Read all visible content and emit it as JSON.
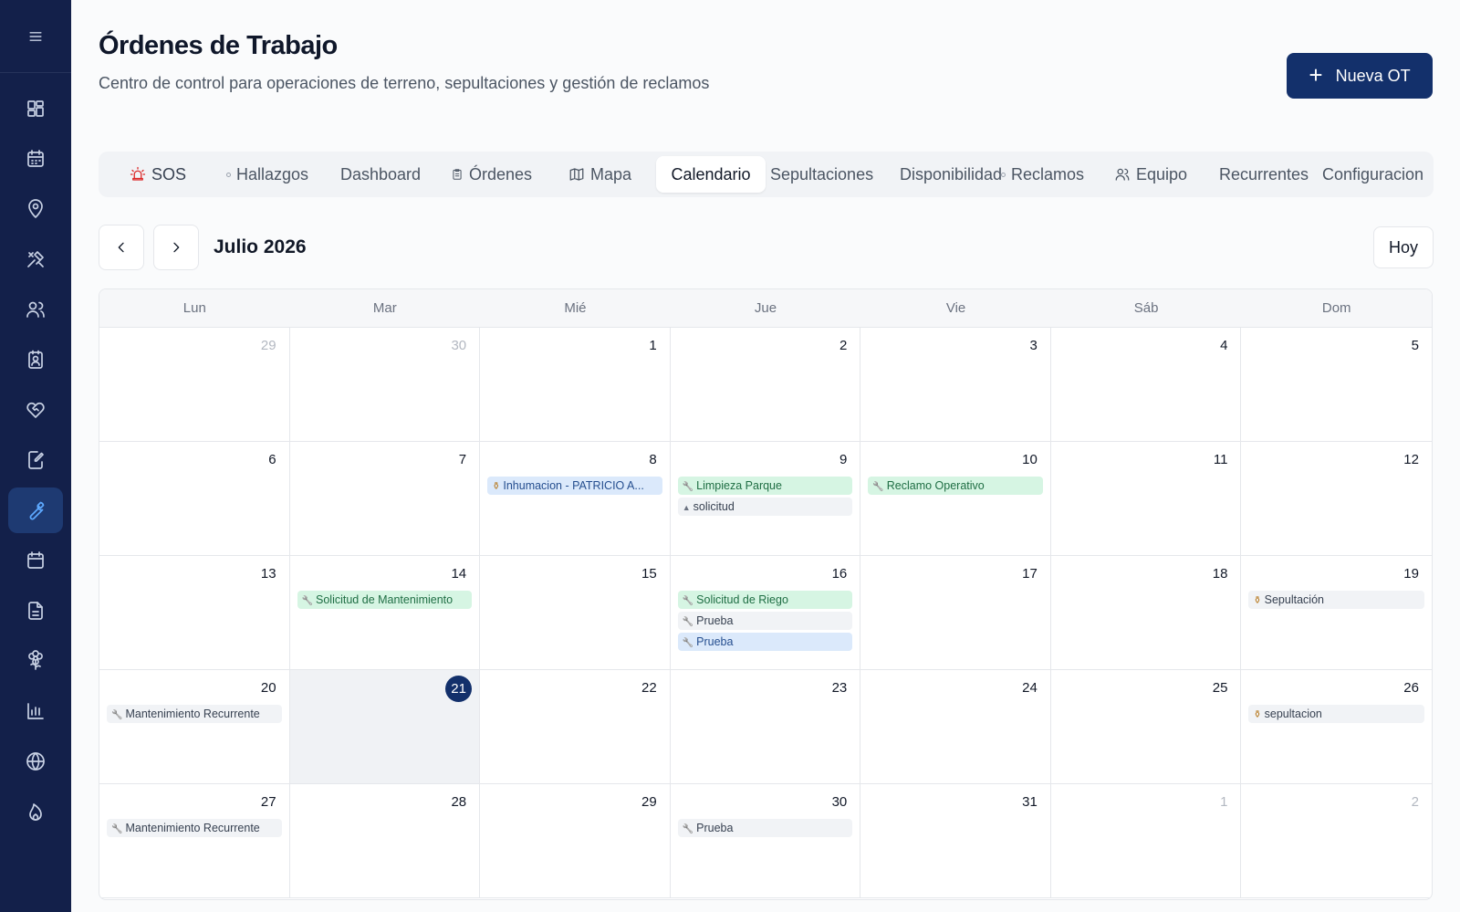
{
  "sidebar": {
    "menu_icon": "hamburger-icon",
    "items": [
      {
        "icon": "dashboard-grid-icon"
      },
      {
        "icon": "calendar-icon"
      },
      {
        "icon": "map-pin-icon"
      },
      {
        "icon": "tools-icon"
      },
      {
        "icon": "users-icon"
      },
      {
        "icon": "badge-icon"
      },
      {
        "icon": "heart-handshake-icon"
      },
      {
        "icon": "edit-document-icon"
      },
      {
        "icon": "wrench-icon",
        "active": true
      },
      {
        "icon": "calendar-outline-icon"
      },
      {
        "icon": "document-icon"
      },
      {
        "icon": "flower-icon"
      },
      {
        "icon": "bar-chart-icon"
      },
      {
        "icon": "globe-icon"
      },
      {
        "icon": "flame-icon"
      }
    ]
  },
  "header": {
    "title": "Órdenes de Trabajo",
    "subtitle": "Centro de control para operaciones de terreno, sepultaciones y gestión de reclamos",
    "new_button": "Nueva OT"
  },
  "tabs": [
    {
      "label": "SOS",
      "icon": "siren-icon"
    },
    {
      "label": "Hallazgos",
      "icon": "dot-icon"
    },
    {
      "label": "Dashboard"
    },
    {
      "label": "Órdenes",
      "icon": "clipboard-icon"
    },
    {
      "label": "Mapa",
      "icon": "map-icon"
    },
    {
      "label": "Calendario",
      "active": true
    },
    {
      "label": "Sepultaciones"
    },
    {
      "label": "Disponibilidad"
    },
    {
      "label": "Reclamos",
      "icon": "dot-icon"
    },
    {
      "label": "Equipo",
      "icon": "users-icon"
    },
    {
      "label": "Recurrentes"
    },
    {
      "label": "Configuracion"
    }
  ],
  "calendar": {
    "month_label": "Julio 2026",
    "today_button": "Hoy",
    "weekdays": [
      "Lun",
      "Mar",
      "Mié",
      "Jue",
      "Vie",
      "Sáb",
      "Dom"
    ],
    "today": 21,
    "weeks": [
      [
        {
          "day": "29",
          "muted": true,
          "events": []
        },
        {
          "day": "30",
          "muted": true,
          "events": []
        },
        {
          "day": "1",
          "events": []
        },
        {
          "day": "2",
          "events": []
        },
        {
          "day": "3",
          "events": []
        },
        {
          "day": "4",
          "events": []
        },
        {
          "day": "5",
          "events": []
        }
      ],
      [
        {
          "day": "6",
          "events": []
        },
        {
          "day": "7",
          "events": []
        },
        {
          "day": "8",
          "events": [
            {
              "label": "Inhumacion - PATRICIO A...",
              "color": "blue",
              "icon": "urn-icon"
            }
          ]
        },
        {
          "day": "9",
          "events": [
            {
              "label": "Limpieza Parque",
              "color": "green",
              "icon": "wrench-icon"
            },
            {
              "label": "solicitud",
              "color": "gray",
              "icon": "tombstone-icon"
            }
          ]
        },
        {
          "day": "10",
          "events": [
            {
              "label": "Reclamo Operativo",
              "color": "green",
              "icon": "wrench-icon"
            }
          ]
        },
        {
          "day": "11",
          "events": []
        },
        {
          "day": "12",
          "events": []
        }
      ],
      [
        {
          "day": "13",
          "events": []
        },
        {
          "day": "14",
          "events": [
            {
              "label": "Solicitud de Mantenimiento",
              "color": "green",
              "icon": "wrench-icon"
            }
          ]
        },
        {
          "day": "15",
          "events": []
        },
        {
          "day": "16",
          "events": [
            {
              "label": "Solicitud de Riego",
              "color": "green",
              "icon": "wrench-icon"
            },
            {
              "label": "Prueba",
              "color": "gray",
              "icon": "wrench-icon"
            },
            {
              "label": "Prueba",
              "color": "blue",
              "icon": "wrench-icon"
            }
          ]
        },
        {
          "day": "17",
          "events": []
        },
        {
          "day": "18",
          "events": []
        },
        {
          "day": "19",
          "events": [
            {
              "label": "Sepultación",
              "color": "gray",
              "icon": "urn-icon"
            }
          ]
        }
      ],
      [
        {
          "day": "20",
          "events": [
            {
              "label": "Mantenimiento Recurrente",
              "color": "gray",
              "icon": "wrench-icon"
            }
          ]
        },
        {
          "day": "21",
          "today": true,
          "events": []
        },
        {
          "day": "22",
          "events": []
        },
        {
          "day": "23",
          "events": []
        },
        {
          "day": "24",
          "events": []
        },
        {
          "day": "25",
          "events": []
        },
        {
          "day": "26",
          "events": [
            {
              "label": "sepultacion",
              "color": "gray",
              "icon": "urn-icon"
            }
          ]
        }
      ],
      [
        {
          "day": "27",
          "events": [
            {
              "label": "Mantenimiento Recurrente",
              "color": "gray",
              "icon": "wrench-icon"
            }
          ]
        },
        {
          "day": "28",
          "events": []
        },
        {
          "day": "29",
          "events": []
        },
        {
          "day": "30",
          "events": [
            {
              "label": "Prueba",
              "color": "gray",
              "icon": "wrench-icon"
            }
          ]
        },
        {
          "day": "31",
          "events": []
        },
        {
          "day": "1",
          "muted": true,
          "events": []
        },
        {
          "day": "2",
          "muted": true,
          "events": []
        }
      ]
    ]
  }
}
